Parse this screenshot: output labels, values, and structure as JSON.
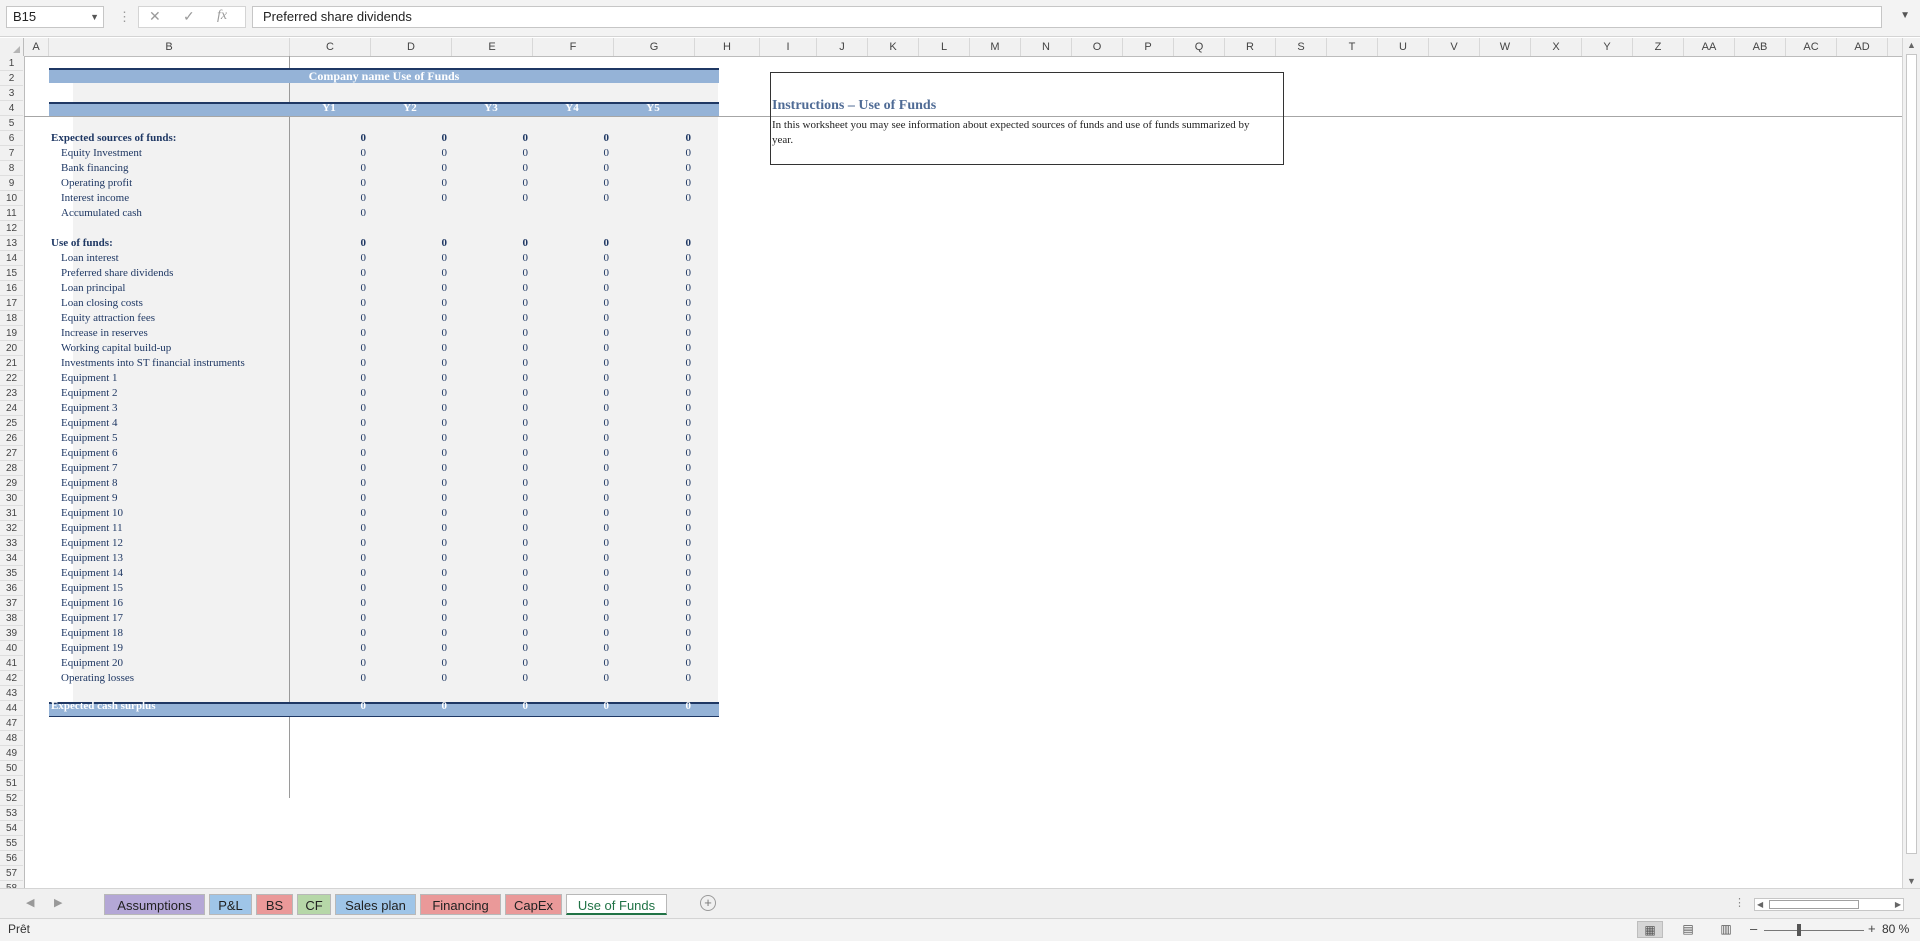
{
  "formula_bar": {
    "name_box": "B15",
    "formula": "Preferred share dividends",
    "cancel_glyph": "✕",
    "enter_glyph": "✓",
    "fx_glyph": "fx"
  },
  "columns": [
    "A",
    "B",
    "C",
    "D",
    "E",
    "F",
    "G",
    "H",
    "I",
    "J",
    "K",
    "L",
    "M",
    "N",
    "O",
    "P",
    "Q",
    "R",
    "S",
    "T",
    "U",
    "V",
    "W",
    "X",
    "Y",
    "Z",
    "AA",
    "AB",
    "AC",
    "AD"
  ],
  "rows": [
    "1",
    "2",
    "3",
    "4",
    "5",
    "6",
    "7",
    "8",
    "9",
    "10",
    "11",
    "12",
    "13",
    "14",
    "15",
    "16",
    "17",
    "18",
    "19",
    "20",
    "21",
    "22",
    "23",
    "24",
    "25",
    "26",
    "27",
    "28",
    "29",
    "30",
    "31",
    "32",
    "33",
    "34",
    "35",
    "36",
    "37",
    "38",
    "39",
    "40",
    "41",
    "42",
    "43",
    "44",
    "47",
    "48",
    "49",
    "50",
    "51",
    "52",
    "53",
    "54",
    "55",
    "56",
    "57",
    "58"
  ],
  "sheet": {
    "title": "Company name Use of Funds",
    "year_headers": [
      "Y1",
      "Y2",
      "Y3",
      "Y4",
      "Y5"
    ],
    "sources_header": "Expected sources of funds:",
    "sources_totals": [
      "0",
      "0",
      "0",
      "0",
      "0"
    ],
    "sources": [
      {
        "label": "Equity Investment",
        "values": [
          "0",
          "0",
          "0",
          "0",
          "0"
        ]
      },
      {
        "label": "Bank financing",
        "values": [
          "0",
          "0",
          "0",
          "0",
          "0"
        ]
      },
      {
        "label": "Operating profit",
        "values": [
          "0",
          "0",
          "0",
          "0",
          "0"
        ]
      },
      {
        "label": "Interest income",
        "values": [
          "0",
          "0",
          "0",
          "0",
          "0"
        ]
      },
      {
        "label": "Accumulated cash",
        "values": [
          "0"
        ]
      }
    ],
    "uses_header": "Use of funds:",
    "uses_totals": [
      "0",
      "0",
      "0",
      "0",
      "0"
    ],
    "uses": [
      {
        "label": "Loan interest",
        "values": [
          "0",
          "0",
          "0",
          "0",
          "0"
        ]
      },
      {
        "label": "Preferred share dividends",
        "values": [
          "0",
          "0",
          "0",
          "0",
          "0"
        ]
      },
      {
        "label": "Loan principal",
        "values": [
          "0",
          "0",
          "0",
          "0",
          "0"
        ]
      },
      {
        "label": "Loan closing costs",
        "values": [
          "0",
          "0",
          "0",
          "0",
          "0"
        ]
      },
      {
        "label": "Equity attraction fees",
        "values": [
          "0",
          "0",
          "0",
          "0",
          "0"
        ]
      },
      {
        "label": "Increase in reserves",
        "values": [
          "0",
          "0",
          "0",
          "0",
          "0"
        ]
      },
      {
        "label": "Working capital build-up",
        "values": [
          "0",
          "0",
          "0",
          "0",
          "0"
        ]
      },
      {
        "label": "Investments into ST financial instruments",
        "values": [
          "0",
          "0",
          "0",
          "0",
          "0"
        ]
      },
      {
        "label": "Equipment 1",
        "values": [
          "0",
          "0",
          "0",
          "0",
          "0"
        ]
      },
      {
        "label": "Equipment 2",
        "values": [
          "0",
          "0",
          "0",
          "0",
          "0"
        ]
      },
      {
        "label": "Equipment 3",
        "values": [
          "0",
          "0",
          "0",
          "0",
          "0"
        ]
      },
      {
        "label": "Equipment 4",
        "values": [
          "0",
          "0",
          "0",
          "0",
          "0"
        ]
      },
      {
        "label": "Equipment 5",
        "values": [
          "0",
          "0",
          "0",
          "0",
          "0"
        ]
      },
      {
        "label": "Equipment 6",
        "values": [
          "0",
          "0",
          "0",
          "0",
          "0"
        ]
      },
      {
        "label": "Equipment 7",
        "values": [
          "0",
          "0",
          "0",
          "0",
          "0"
        ]
      },
      {
        "label": "Equipment 8",
        "values": [
          "0",
          "0",
          "0",
          "0",
          "0"
        ]
      },
      {
        "label": "Equipment 9",
        "values": [
          "0",
          "0",
          "0",
          "0",
          "0"
        ]
      },
      {
        "label": "Equipment 10",
        "values": [
          "0",
          "0",
          "0",
          "0",
          "0"
        ]
      },
      {
        "label": "Equipment 11",
        "values": [
          "0",
          "0",
          "0",
          "0",
          "0"
        ]
      },
      {
        "label": "Equipment 12",
        "values": [
          "0",
          "0",
          "0",
          "0",
          "0"
        ]
      },
      {
        "label": "Equipment 13",
        "values": [
          "0",
          "0",
          "0",
          "0",
          "0"
        ]
      },
      {
        "label": "Equipment 14",
        "values": [
          "0",
          "0",
          "0",
          "0",
          "0"
        ]
      },
      {
        "label": "Equipment 15",
        "values": [
          "0",
          "0",
          "0",
          "0",
          "0"
        ]
      },
      {
        "label": "Equipment 16",
        "values": [
          "0",
          "0",
          "0",
          "0",
          "0"
        ]
      },
      {
        "label": "Equipment 17",
        "values": [
          "0",
          "0",
          "0",
          "0",
          "0"
        ]
      },
      {
        "label": "Equipment 18",
        "values": [
          "0",
          "0",
          "0",
          "0",
          "0"
        ]
      },
      {
        "label": "Equipment 19",
        "values": [
          "0",
          "0",
          "0",
          "0",
          "0"
        ]
      },
      {
        "label": "Equipment 20",
        "values": [
          "0",
          "0",
          "0",
          "0",
          "0"
        ]
      },
      {
        "label": "Operating losses",
        "values": [
          "0",
          "0",
          "0",
          "0",
          "0"
        ]
      }
    ],
    "surplus_label": "Expected cash surplus",
    "surplus_values": [
      "0",
      "0",
      "0",
      "0",
      "0"
    ]
  },
  "instructions": {
    "title": "Instructions – Use of Funds",
    "text": "In this worksheet you may see information about expected sources of funds and use of funds summarized by year."
  },
  "tabs": [
    {
      "label": "Assumptions",
      "color": "#b4a7d6"
    },
    {
      "label": "P&L",
      "color": "#9fc5e8"
    },
    {
      "label": "BS",
      "color": "#ea9999"
    },
    {
      "label": "CF",
      "color": "#b6d7a8"
    },
    {
      "label": "Sales plan",
      "color": "#9fc5e8"
    },
    {
      "label": "Financing",
      "color": "#ea9999"
    },
    {
      "label": "CapEx",
      "color": "#ea9999"
    },
    {
      "label": "Use of Funds",
      "color": "#ffffff"
    }
  ],
  "status": {
    "text": "Prêt",
    "zoom": "80 %"
  },
  "colors": {
    "header_band": "#95b3d7",
    "band_line": "#1f3864",
    "active_tab_text": "#217346"
  }
}
